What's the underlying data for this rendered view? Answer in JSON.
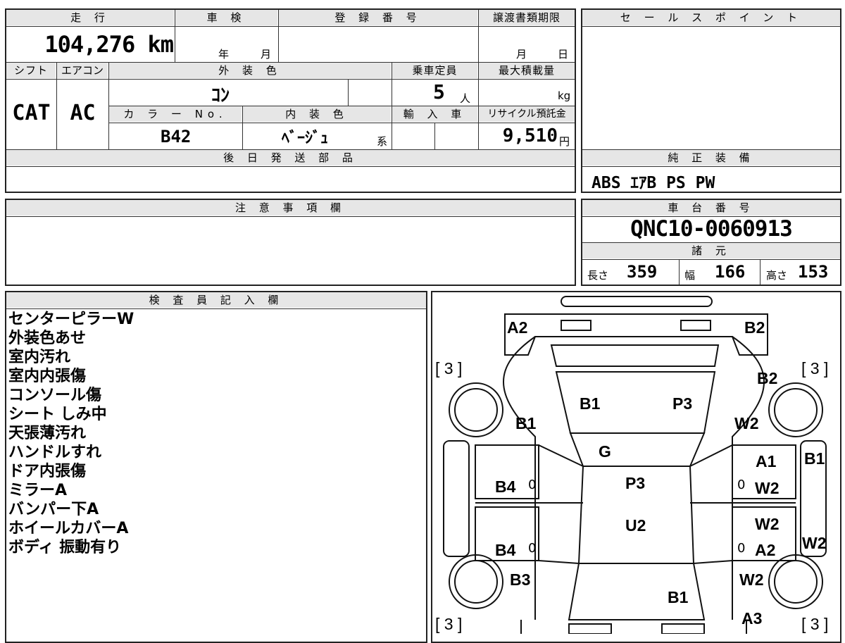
{
  "form": {
    "mileage": {
      "label": "走 行",
      "value": "104,276 km"
    },
    "inspection": {
      "label": "車 検",
      "year_unit": "年",
      "month_unit": "月"
    },
    "registration": {
      "label": "登 録 番 号",
      "value": ""
    },
    "transfer": {
      "label": "譲渡書類期限",
      "month_unit": "月",
      "day_unit": "日"
    },
    "shift": {
      "label": "シフト",
      "value": "CAT"
    },
    "aircon": {
      "label": "エアコン",
      "value": "AC"
    },
    "exterior_color": {
      "label": "外 装 色",
      "value": "ｺﾝ"
    },
    "capacity": {
      "label": "乗車定員",
      "value": "5",
      "unit": "人"
    },
    "max_load": {
      "label": "最大積載量",
      "unit": "kg"
    },
    "color_no": {
      "label": "カ ラ ー No.",
      "value": "B42"
    },
    "interior_color": {
      "label": "内 装 色",
      "value": "ﾍﾞｰｼﾞｭ",
      "unit": "系"
    },
    "import": {
      "label": "輸 入 車"
    },
    "recycle": {
      "label": "リサイクル預託金",
      "value": "9,510",
      "unit": "円"
    },
    "later_parts": {
      "label": "後 日 発 送 部 品"
    },
    "caution": {
      "label": "注 意 事 項 欄"
    },
    "sales_point": {
      "label": "セ ー ル ス ポ イ ン ト"
    },
    "equipment": {
      "label": "純 正 装 備",
      "value": "ABS ｴｱB PS PW"
    },
    "chassis": {
      "label": "車 台 番 号",
      "value": "QNC10-0060913"
    },
    "specs": {
      "label": "諸 元",
      "length_label": "長さ",
      "length": "359",
      "width_label": "幅",
      "width": "166",
      "height_label": "高さ",
      "height": "153"
    },
    "inspector": {
      "label": "検 査 員 記 入 欄",
      "notes": [
        "センターピラーW",
        "外装色あせ",
        "室内汚れ",
        "室内内張傷",
        "コンソール傷",
        "シート しみ中",
        "天張薄汚れ",
        "ハンドルすれ",
        "ドア内張傷",
        "ミラーA",
        "バンパー下A",
        "ホイールカバーA",
        "ボディ 振動有り"
      ]
    }
  },
  "diagram": {
    "marks": [
      "A2",
      "B2",
      "B2",
      "B1",
      "P3",
      "B1",
      "W2",
      "G",
      "A1",
      "B1",
      "B4",
      "P3",
      "W2",
      "U2",
      "W2",
      "B4",
      "A2",
      "W2",
      "B3",
      "W2",
      "B1",
      "A3"
    ],
    "tire_marks": [
      "[ 3 ]",
      "[ 3 ]",
      "[ 3 ]",
      "[ 3 ]"
    ],
    "zeros": [
      "0",
      "0",
      "0",
      "0"
    ]
  }
}
